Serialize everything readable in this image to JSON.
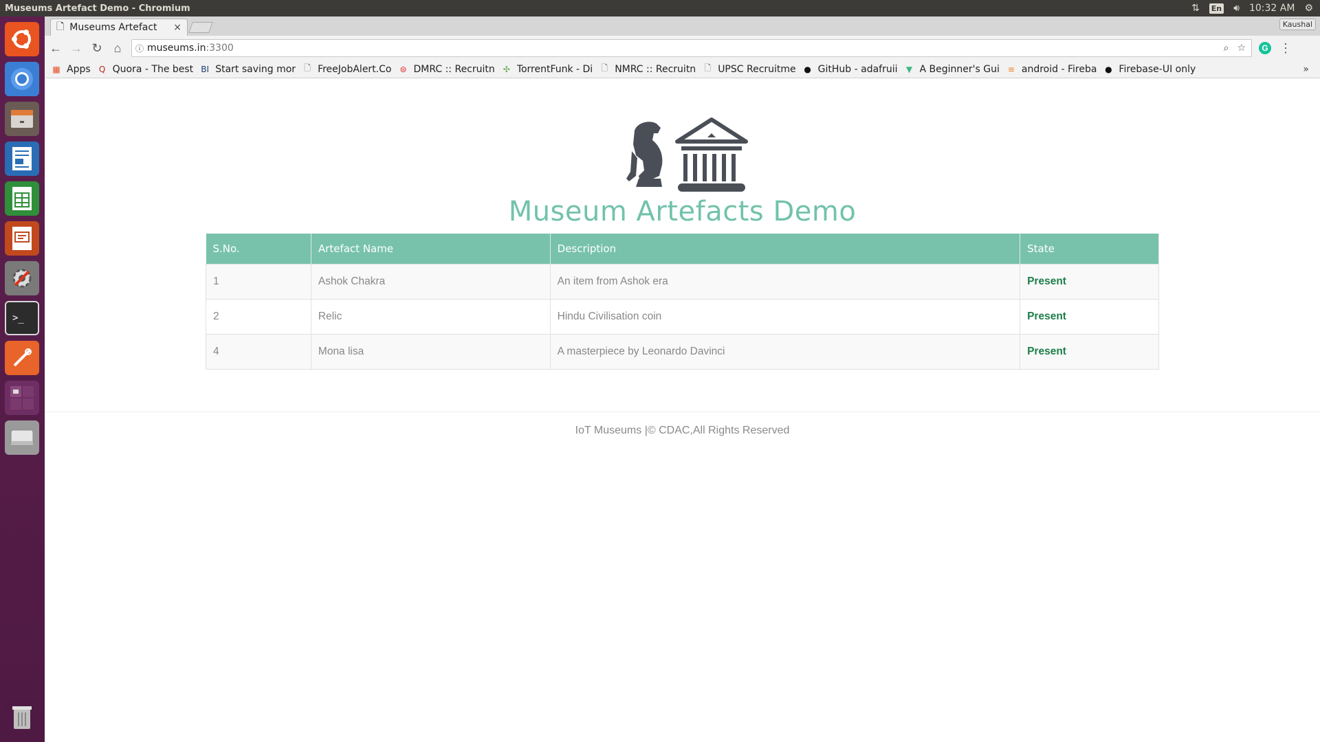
{
  "window": {
    "title": "Museums Artefact Demo - Chromium"
  },
  "system_tray": {
    "language": "En",
    "time": "10:32 AM",
    "icons": [
      "network-icon",
      "volume-icon",
      "settings-gear-icon"
    ]
  },
  "launcher": {
    "items": [
      "ubuntu-dash-icon",
      "chromium-icon",
      "files-icon",
      "writer-icon",
      "calc-icon",
      "impress-icon",
      "system-settings-icon",
      "terminal-icon",
      "pencil-app-icon",
      "workspaces-icon",
      "disk-icon",
      "trash-icon"
    ]
  },
  "browser": {
    "tab": {
      "title": "Museums Artefact",
      "close": "×"
    },
    "profile": "Kaushal",
    "address": {
      "host": "museums.in",
      "port": ":3300"
    },
    "extension_badge": "G",
    "bookmarks": [
      {
        "label": "Apps",
        "icon": "apps-grid-icon",
        "color": "#e44d26"
      },
      {
        "label": "Quora - The best",
        "icon": "quora-icon",
        "color": "#b92b27"
      },
      {
        "label": "Start saving mor",
        "icon": "bi-icon",
        "color": "#1d3d6d"
      },
      {
        "label": "FreeJobAlert.Co",
        "icon": "page-icon",
        "color": "#666666"
      },
      {
        "label": "DMRC :: Recruitn",
        "icon": "dmrc-icon",
        "color": "#e02020"
      },
      {
        "label": "TorrentFunk - Di",
        "icon": "torrent-icon",
        "color": "#6aa84f"
      },
      {
        "label": "NMRC :: Recruitn",
        "icon": "page-icon",
        "color": "#666666"
      },
      {
        "label": "UPSC Recruitme",
        "icon": "page-icon",
        "color": "#666666"
      },
      {
        "label": "GitHub - adafruii",
        "icon": "github-icon",
        "color": "#111111"
      },
      {
        "label": "A Beginner's Gui",
        "icon": "vue-icon",
        "color": "#41b883"
      },
      {
        "label": "android - Fireba",
        "icon": "stackoverflow-icon",
        "color": "#f48024"
      },
      {
        "label": "Firebase-UI only",
        "icon": "github-icon",
        "color": "#111111"
      }
    ],
    "bookmarks_more": "»"
  },
  "site": {
    "title": "Museum Artefacts Demo",
    "accent": "#72c2ab",
    "table": {
      "headers": [
        "S.No.",
        "Artefact Name",
        "Description",
        "State"
      ],
      "rows": [
        {
          "sno": "1",
          "name": "Ashok Chakra",
          "description": "An item from Ashok era",
          "state": "Present"
        },
        {
          "sno": "2",
          "name": "Relic",
          "description": "Hindu Civilisation coin",
          "state": "Present"
        },
        {
          "sno": "4",
          "name": "Mona lisa",
          "description": "A masterpiece by Leonardo Davinci",
          "state": "Present"
        }
      ]
    },
    "footer": "IoT Museums |© CDAC,All Rights Reserved"
  }
}
